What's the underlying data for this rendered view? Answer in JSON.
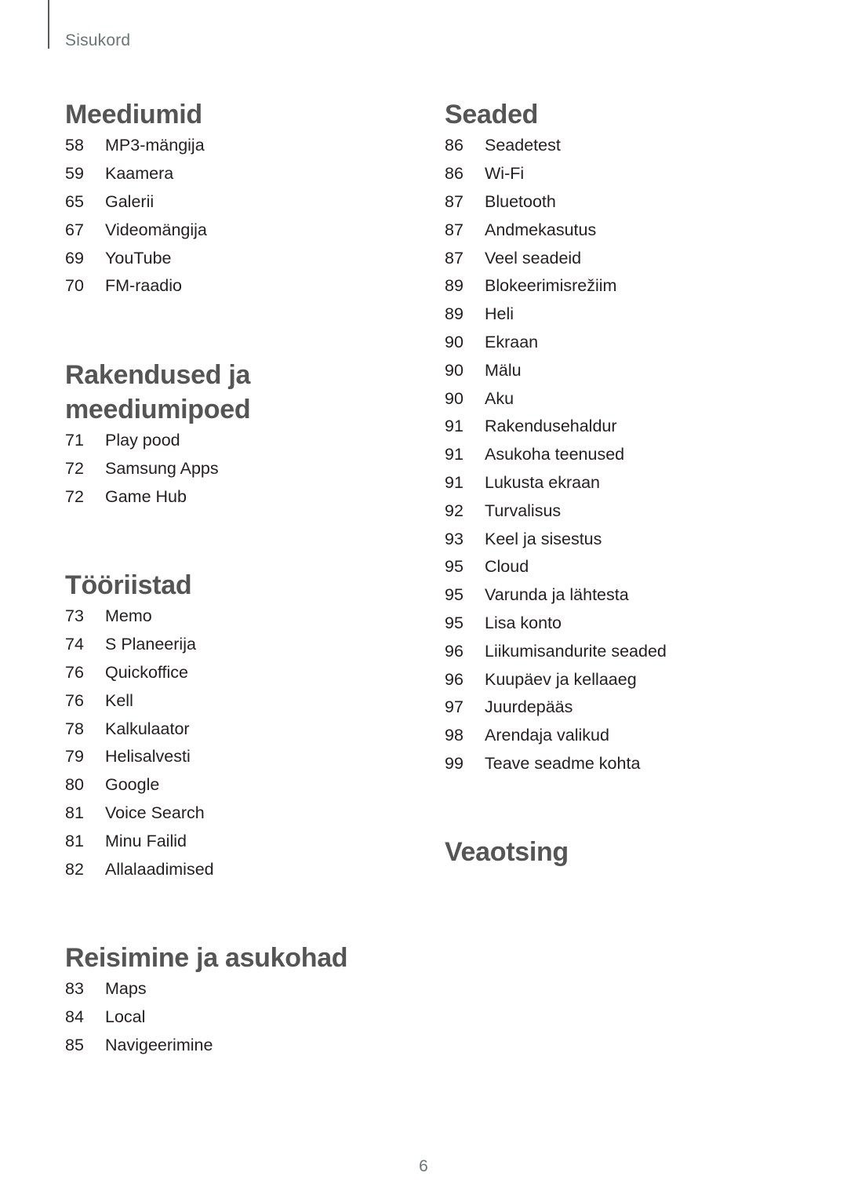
{
  "header": {
    "running_title": "Sisukord"
  },
  "left_column": [
    {
      "title": "Meediumid",
      "items": [
        {
          "page": "58",
          "label": "MP3-mängija"
        },
        {
          "page": "59",
          "label": "Kaamera"
        },
        {
          "page": "65",
          "label": "Galerii"
        },
        {
          "page": "67",
          "label": "Videomängija"
        },
        {
          "page": "69",
          "label": "YouTube"
        },
        {
          "page": "70",
          "label": "FM-raadio"
        }
      ]
    },
    {
      "title_line1": "Rakendused ja",
      "title_line2": "meediumipoed",
      "items": [
        {
          "page": "71",
          "label": "Play pood"
        },
        {
          "page": "72",
          "label": "Samsung Apps"
        },
        {
          "page": "72",
          "label": "Game Hub"
        }
      ]
    },
    {
      "title": "Tööriistad",
      "items": [
        {
          "page": "73",
          "label": "Memo"
        },
        {
          "page": "74",
          "label": "S Planeerija"
        },
        {
          "page": "76",
          "label": "Quickoffice"
        },
        {
          "page": "76",
          "label": "Kell"
        },
        {
          "page": "78",
          "label": "Kalkulaator"
        },
        {
          "page": "79",
          "label": "Helisalvesti"
        },
        {
          "page": "80",
          "label": "Google"
        },
        {
          "page": "81",
          "label": "Voice Search"
        },
        {
          "page": "81",
          "label": "Minu Failid"
        },
        {
          "page": "82",
          "label": "Allalaadimised"
        }
      ]
    },
    {
      "title": "Reisimine ja asukohad",
      "items": [
        {
          "page": "83",
          "label": "Maps"
        },
        {
          "page": "84",
          "label": "Local"
        },
        {
          "page": "85",
          "label": "Navigeerimine"
        }
      ]
    }
  ],
  "right_column": [
    {
      "title": "Seaded",
      "items": [
        {
          "page": "86",
          "label": "Seadetest"
        },
        {
          "page": "86",
          "label": "Wi-Fi"
        },
        {
          "page": "87",
          "label": "Bluetooth"
        },
        {
          "page": "87",
          "label": "Andmekasutus"
        },
        {
          "page": "87",
          "label": "Veel seadeid"
        },
        {
          "page": "89",
          "label": "Blokeerimisrežiim"
        },
        {
          "page": "89",
          "label": "Heli"
        },
        {
          "page": "90",
          "label": "Ekraan"
        },
        {
          "page": "90",
          "label": "Mälu"
        },
        {
          "page": "90",
          "label": "Aku"
        },
        {
          "page": "91",
          "label": "Rakendusehaldur"
        },
        {
          "page": "91",
          "label": "Asukoha teenused"
        },
        {
          "page": "91",
          "label": "Lukusta ekraan"
        },
        {
          "page": "92",
          "label": "Turvalisus"
        },
        {
          "page": "93",
          "label": "Keel ja sisestus"
        },
        {
          "page": "95",
          "label": "Cloud"
        },
        {
          "page": "95",
          "label": "Varunda ja lähtesta"
        },
        {
          "page": "95",
          "label": "Lisa konto"
        },
        {
          "page": "96",
          "label": "Liikumisandurite seaded"
        },
        {
          "page": "96",
          "label": "Kuupäev ja kellaaeg"
        },
        {
          "page": "97",
          "label": "Juurdepääs"
        },
        {
          "page": "98",
          "label": "Arendaja valikud"
        },
        {
          "page": "99",
          "label": "Teave seadme kohta"
        }
      ]
    },
    {
      "title": "Veaotsing",
      "items": []
    }
  ],
  "footer": {
    "page_number": "6"
  }
}
